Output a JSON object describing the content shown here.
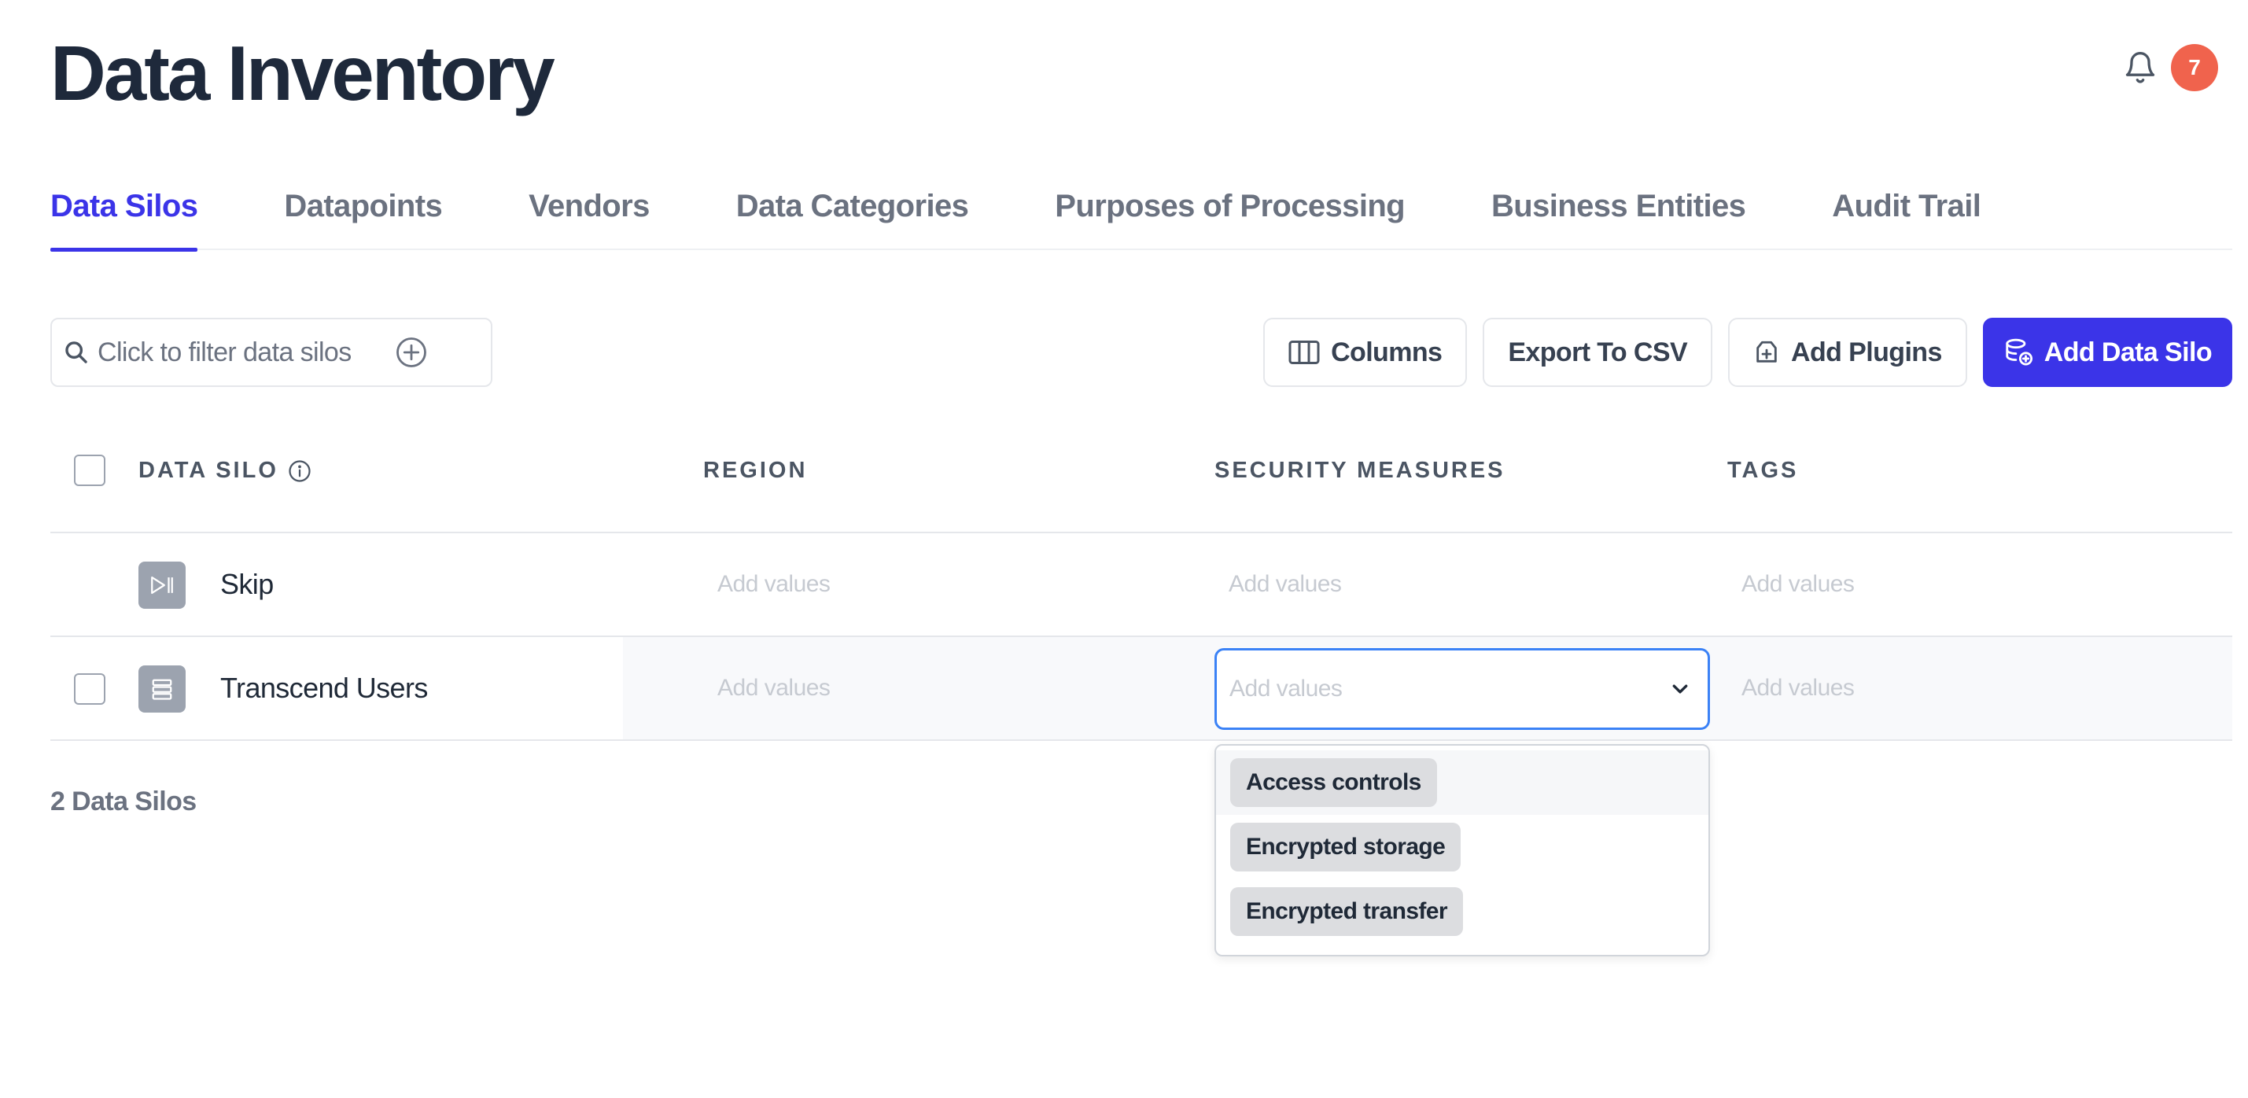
{
  "page": {
    "title": "Data Inventory"
  },
  "notifications": {
    "count": "7",
    "badge_color": "#f0634d"
  },
  "tabs": [
    {
      "label": "Data Silos",
      "active": true
    },
    {
      "label": "Datapoints",
      "active": false
    },
    {
      "label": "Vendors",
      "active": false
    },
    {
      "label": "Data Categories",
      "active": false
    },
    {
      "label": "Purposes of Processing",
      "active": false
    },
    {
      "label": "Business Entities",
      "active": false
    },
    {
      "label": "Audit Trail",
      "active": false
    }
  ],
  "filter": {
    "placeholder": "Click to filter data silos"
  },
  "toolbar": {
    "columns": "Columns",
    "export": "Export To CSV",
    "plugins": "Add Plugins",
    "add_silo": "Add Data Silo"
  },
  "table": {
    "headers": {
      "silo": "DATA SILO",
      "region": "REGION",
      "security": "SECURITY MEASURES",
      "tags": "TAGS"
    },
    "rows": [
      {
        "name": "Skip",
        "icon": "skip-icon",
        "region": "Add values",
        "security": "Add values",
        "tags": "Add values"
      },
      {
        "name": "Transcend Users",
        "icon": "database-list-icon",
        "region": "Add values",
        "security": "Add values",
        "tags": "Add values"
      }
    ]
  },
  "dropdown": {
    "placeholder": "Add values",
    "options": [
      "Access controls",
      "Encrypted storage",
      "Encrypted transfer"
    ]
  },
  "footer": {
    "count": "2 Data Silos"
  },
  "colors": {
    "accent": "#3b34e8",
    "focus": "#3b82f6",
    "title": "#1e293b"
  }
}
